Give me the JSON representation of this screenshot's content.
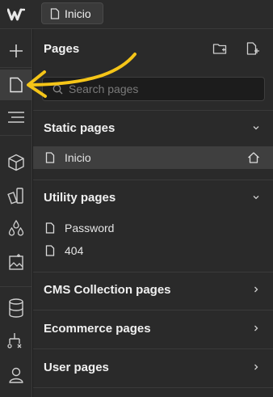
{
  "topbar": {
    "current_page": "Inicio"
  },
  "panel": {
    "title": "Pages"
  },
  "search": {
    "placeholder": "Search pages"
  },
  "sections": {
    "static": {
      "title": "Static pages",
      "pages": [
        {
          "label": "Inicio",
          "is_home": true
        }
      ]
    },
    "utility": {
      "title": "Utility pages",
      "pages": [
        {
          "label": "Password"
        },
        {
          "label": "404"
        }
      ]
    },
    "cms": {
      "title": "CMS Collection pages"
    },
    "ecommerce": {
      "title": "Ecommerce pages"
    },
    "user": {
      "title": "User pages"
    }
  },
  "colors": {
    "annotation_arrow": "#f5c518",
    "background": "#1e1e1e",
    "panel": "#2a2a2a",
    "selected_row": "#3f3f3f"
  }
}
